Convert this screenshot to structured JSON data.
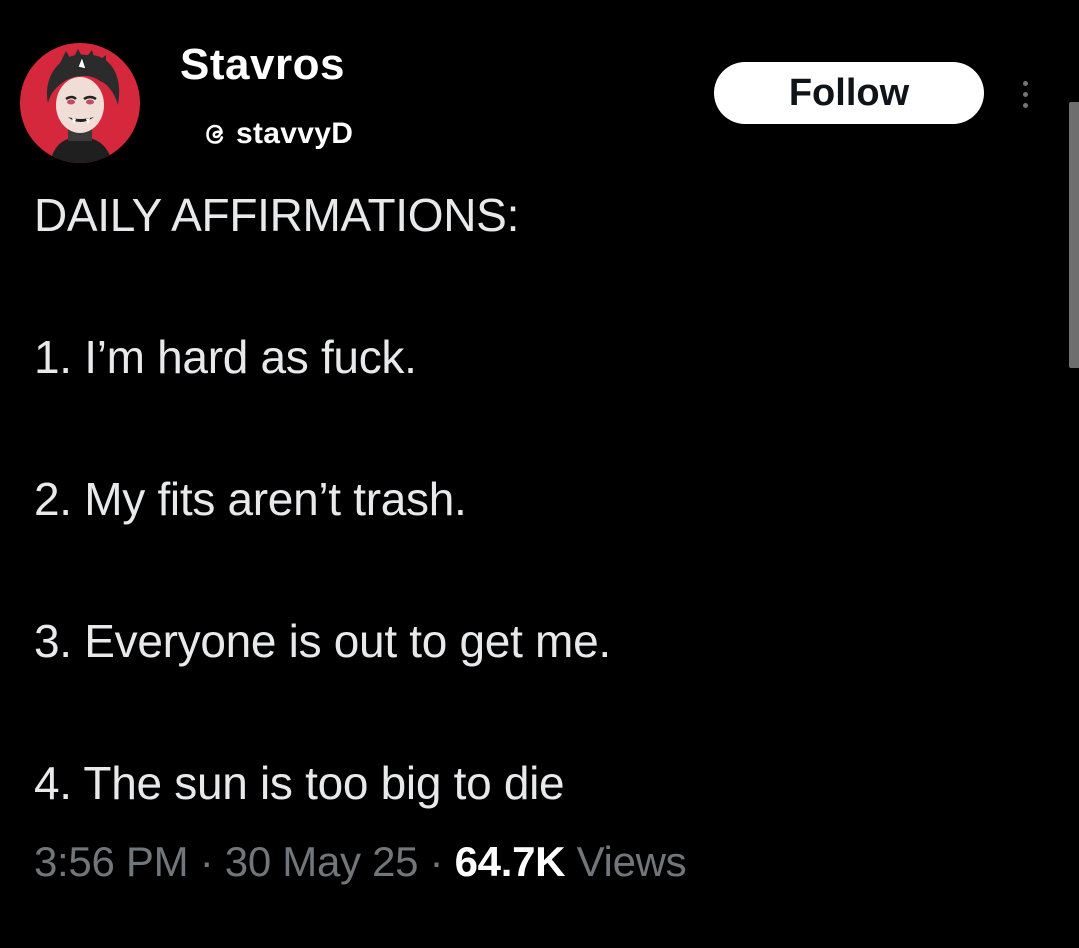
{
  "author": {
    "display_name": "Stavros",
    "handle": "stavvyD",
    "handle_icon": "threads-icon"
  },
  "actions": {
    "follow_label": "Follow",
    "more_icon": "more-options-icon"
  },
  "post": {
    "lines": [
      "DAILY AFFIRMATIONS:",
      "1. I’m hard as fuck.",
      "2. My fits aren’t trash.",
      "3. Everyone is out to get me.",
      "4. The sun is too big to die"
    ]
  },
  "meta": {
    "time": "3:56 PM",
    "separator": " · ",
    "date": "30 May 25",
    "views_count": "64.7K",
    "views_label": "Views"
  },
  "colors": {
    "background": "#000000",
    "text_primary": "#e7e9ea",
    "text_secondary": "#71767b",
    "follow_bg": "#ffffff",
    "avatar_bg": "#d6283c"
  }
}
